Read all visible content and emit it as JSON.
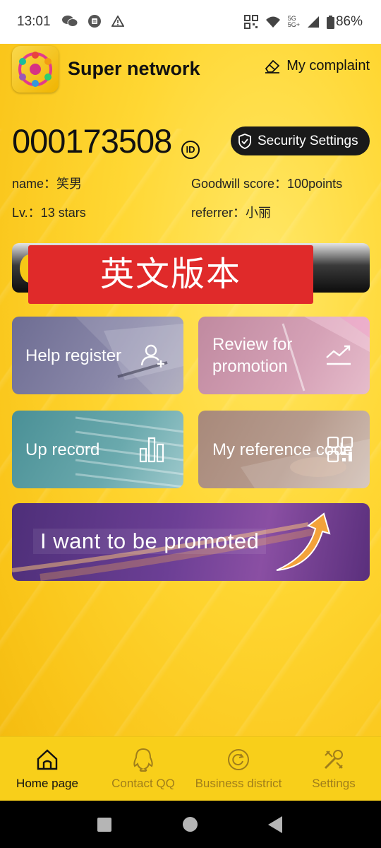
{
  "status": {
    "time": "13:01",
    "network_top": "5G",
    "network_bottom": "5G+",
    "battery": "86%"
  },
  "header": {
    "title": "Super network",
    "complaint_label": "My complaint"
  },
  "profile": {
    "id": "000173508",
    "id_badge": "ID",
    "security_label": "Security Settings",
    "name_label": "name：",
    "name_value": "笑男",
    "goodwill_label": "Goodwill score：",
    "goodwill_value": "100points",
    "level_label": "Lv.：",
    "level_value": "13 stars",
    "referrer_label": "referrer：",
    "referrer_value": "小丽"
  },
  "banner": {
    "overlay_text": "英文版本"
  },
  "cards": {
    "help_register": "Help register",
    "review_line1": "Review for",
    "review_line2": "promotion",
    "up_record": "Up record",
    "my_reference": "My reference code",
    "promote": "I want to be promoted"
  },
  "tabs": [
    {
      "label": "Home page",
      "icon": "home-icon",
      "active": true
    },
    {
      "label": "Contact QQ",
      "icon": "qq-penguin-icon",
      "active": false
    },
    {
      "label": "Business district",
      "icon": "business-circle-icon",
      "active": false
    },
    {
      "label": "Settings",
      "icon": "tools-icon",
      "active": false
    }
  ],
  "colors": {
    "background": "#f9c418",
    "security_button": "#1a1a1a",
    "red_label": "#e02a2a",
    "tab_active": "#111111",
    "tab_inactive": "#a07e1a"
  }
}
